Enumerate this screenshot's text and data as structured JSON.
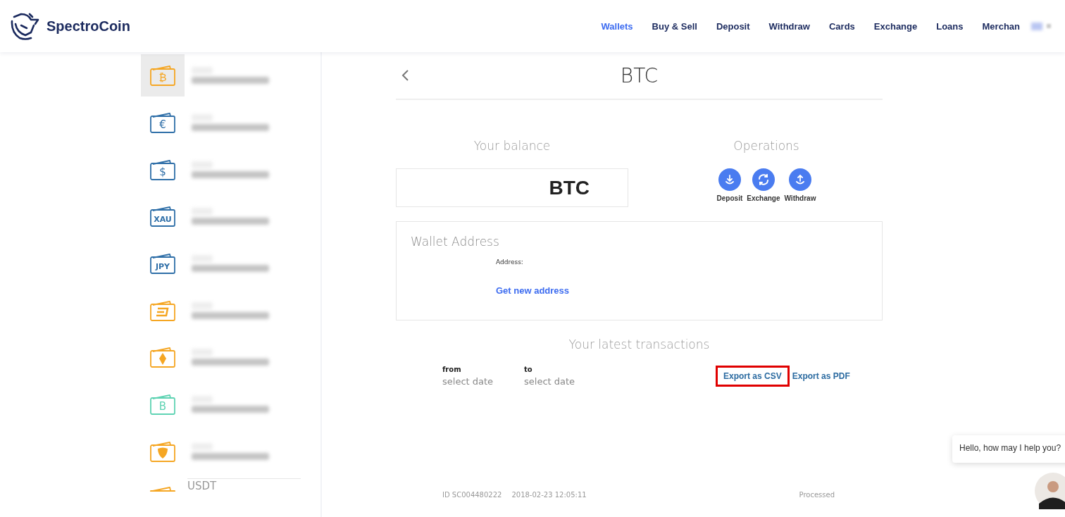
{
  "brand": {
    "name": "SpectroCoin"
  },
  "nav": [
    {
      "label": "Wallets",
      "selected": true
    },
    {
      "label": "Buy & Sell",
      "selected": false
    },
    {
      "label": "Deposit",
      "selected": false
    },
    {
      "label": "Withdraw",
      "selected": false
    },
    {
      "label": "Cards",
      "selected": false
    },
    {
      "label": "Exchange",
      "selected": false
    },
    {
      "label": "Loans",
      "selected": false
    },
    {
      "label": "Merchan",
      "selected": false
    }
  ],
  "wallets": [
    {
      "kind": "code",
      "symbol": "₿",
      "color": "#f5a623",
      "selected": true
    },
    {
      "kind": "code",
      "symbol": "€",
      "color": "#2f6fa8",
      "selected": false
    },
    {
      "kind": "code",
      "symbol": "$",
      "color": "#2f6fa8",
      "selected": false
    },
    {
      "kind": "code",
      "symbol": "XAU",
      "color": "#2f6fa8",
      "selected": false
    },
    {
      "kind": "code",
      "symbol": "JPY",
      "color": "#2f6fa8",
      "selected": false
    },
    {
      "kind": "dash",
      "color": "#f5a623",
      "selected": false
    },
    {
      "kind": "eth",
      "color": "#f5a623",
      "selected": false
    },
    {
      "kind": "code",
      "symbol": "B",
      "color": "#5fd3b3",
      "selected": false
    },
    {
      "kind": "nem",
      "color": "#f5a623",
      "selected": false
    },
    {
      "kind": "partial",
      "label": "USDT",
      "color": "#f5a623",
      "selected": false
    }
  ],
  "page": {
    "title": "BTC"
  },
  "balance": {
    "heading": "Your balance",
    "value": "BTC"
  },
  "operations": {
    "heading": "Operations",
    "items": [
      {
        "kind": "deposit",
        "label": "Deposit"
      },
      {
        "kind": "exchange",
        "label": "Exchange"
      },
      {
        "kind": "withdraw",
        "label": "Withdraw"
      }
    ]
  },
  "wallet_address": {
    "heading": "Wallet Address",
    "address_label": "Address:",
    "link": "Get new address"
  },
  "transactions": {
    "heading": "Your latest transactions",
    "filters": [
      {
        "label": "from",
        "placeholder": "select date"
      },
      {
        "label": "to",
        "placeholder": "select date"
      }
    ],
    "exports": [
      {
        "label": "Export as CSV",
        "highlighted": true
      },
      {
        "label": "Export as PDF",
        "highlighted": false
      }
    ],
    "row": {
      "id": "ID SC004480222",
      "date": "2018-02-23 12:05:11",
      "status": "Processed"
    }
  },
  "chat": {
    "message": "Hello, how may I help you?"
  }
}
